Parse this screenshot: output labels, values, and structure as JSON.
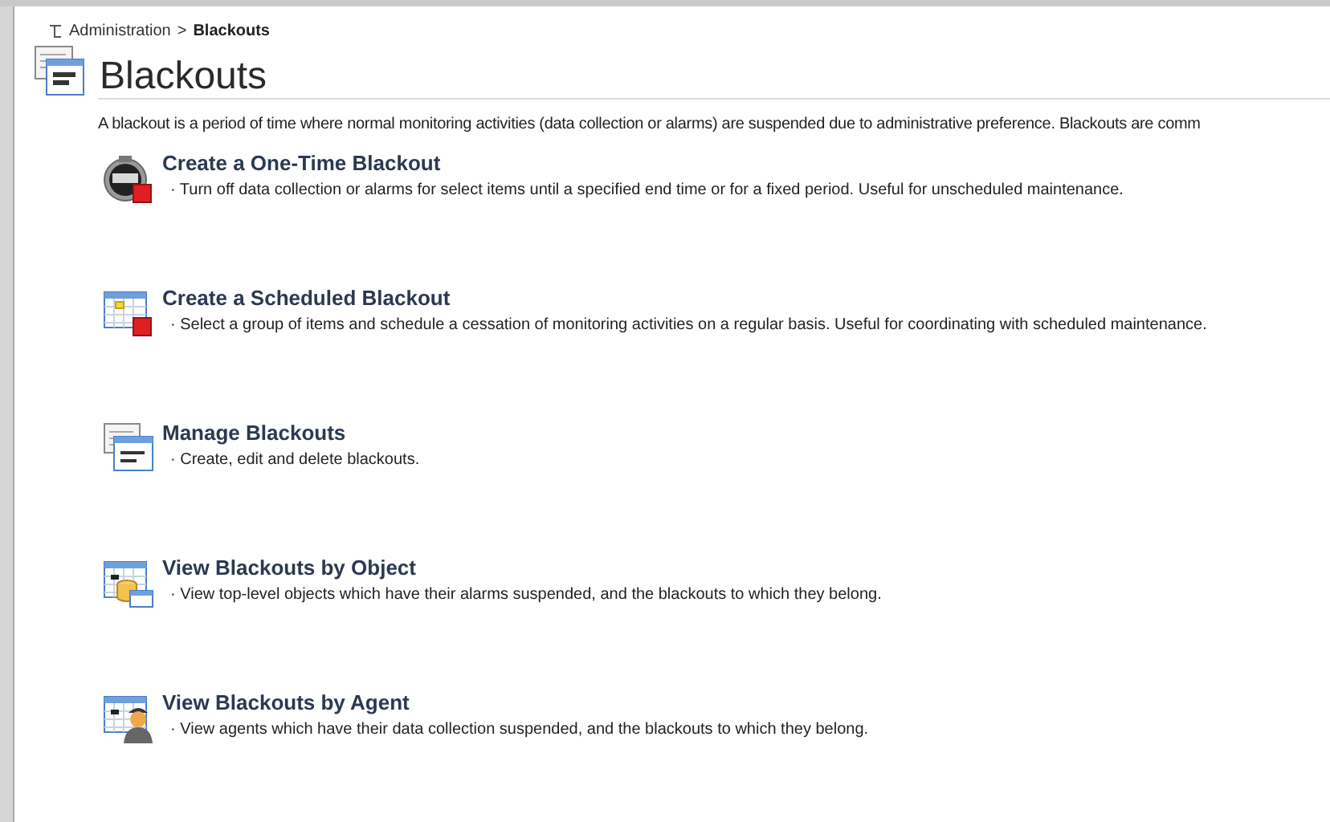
{
  "breadcrumb": {
    "parent": "Administration",
    "separator": ">",
    "current": "Blackouts"
  },
  "header": {
    "title": "Blackouts",
    "description": "A blackout is a period of time where normal monitoring activities (data collection or alarms) are suspended due to administrative preference. Blackouts are comm"
  },
  "items": [
    {
      "kind": "stopwatch",
      "title": "Create a One-Time Blackout",
      "description": "· Turn off data collection or alarms for select items until a specified end time or for a fixed period. Useful for unscheduled maintenance."
    },
    {
      "kind": "calendar",
      "title": "Create a Scheduled Blackout",
      "description": "· Select a group of items and schedule a cessation of monitoring activities on a regular basis. Useful for coordinating with scheduled maintenance."
    },
    {
      "kind": "manage",
      "title": "Manage Blackouts",
      "description": "· Create, edit and delete blackouts."
    },
    {
      "kind": "object",
      "title": "View Blackouts by Object",
      "description": "· View top-level objects which have their alarms suspended, and the blackouts to which they belong."
    },
    {
      "kind": "agent",
      "title": "View Blackouts by Agent",
      "description": "· View agents which have their data collection suspended, and the blackouts to which they belong."
    }
  ]
}
